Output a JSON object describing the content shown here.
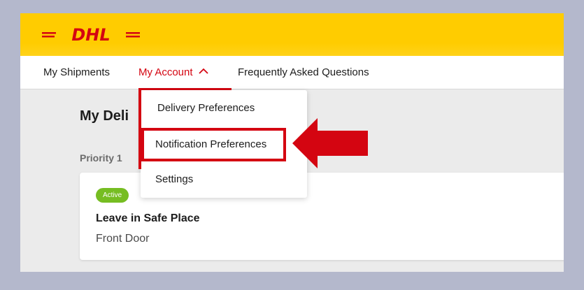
{
  "logo": {
    "text": "DHL",
    "color": "#d40511"
  },
  "header": {
    "color": "#ffcc00"
  },
  "nav": {
    "items": [
      {
        "label": "My Shipments"
      },
      {
        "label": "My Account",
        "active": true,
        "icon": "chevron-up-icon"
      },
      {
        "label": "Frequently Asked Questions"
      }
    ]
  },
  "page": {
    "title": "My Deli",
    "priority_label": "Priority 1"
  },
  "dropdown": {
    "items": [
      {
        "label": "Delivery Preferences"
      },
      {
        "label": "Notification Preferences",
        "highlighted": true
      },
      {
        "label": "Settings"
      }
    ]
  },
  "card": {
    "badge": "Active",
    "title": "Leave in Safe Place",
    "subtitle": "Front Door"
  },
  "colors": {
    "accent": "#d40511",
    "badge_green": "#76bd22"
  },
  "annotation": {
    "icon": "arrow-left-icon"
  }
}
